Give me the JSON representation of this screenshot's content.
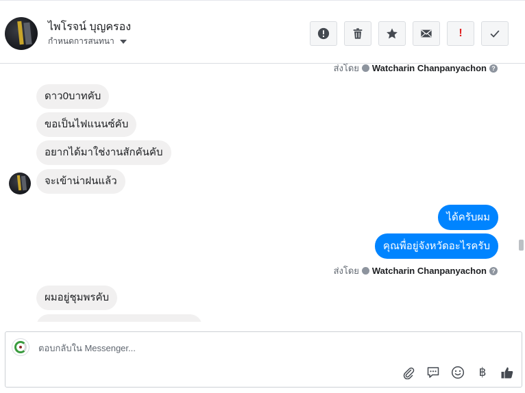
{
  "header": {
    "contact_name": "ไพโรจน์ บุญครอง",
    "conversation_settings": "กำหนดการสนทนา",
    "actions": [
      {
        "name": "report-button",
        "icon": "exclamation-circle-icon"
      },
      {
        "name": "delete-button",
        "icon": "trash-icon"
      },
      {
        "name": "star-button",
        "icon": "star-icon"
      },
      {
        "name": "mark-unread-button",
        "icon": "envelope-icon"
      },
      {
        "name": "spam-button",
        "icon": "exclamation-mark-icon"
      },
      {
        "name": "done-button",
        "icon": "checkmark-icon"
      }
    ]
  },
  "messages": {
    "sent_by_label": "ส่งโดย",
    "sender_name": "Watcharin Chanpanyachon",
    "help_glyph": "?",
    "incoming_1": [
      "ดาว0บาทคับ",
      "ขอเป็นไฟแนนซ์คับ",
      "อยากได้มาใช่งานสักคันคับ",
      "จะเข้าน่าฝนแล้ว"
    ],
    "outgoing": [
      "ได้ครับผม",
      "คุณพื่อยู่จังหวัดอะไรครับ"
    ],
    "incoming_2": [
      "ผมอยู่ชุมพรคับ"
    ]
  },
  "composer": {
    "placeholder": "ตอบกลับใน Messenger...",
    "tools": [
      "paperclip-icon",
      "saved-replies-icon",
      "emoji-icon",
      "payment-icon",
      "like-icon"
    ],
    "payment_glyph": "฿"
  },
  "colors": {
    "outgoing_bubble": "#0084ff",
    "incoming_bubble": "#f1f0f0",
    "spam_accent": "#e02020"
  }
}
